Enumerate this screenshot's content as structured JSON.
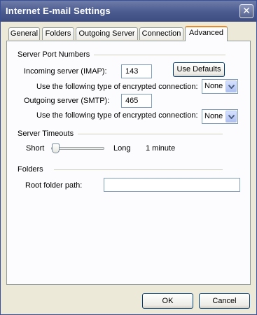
{
  "window": {
    "title": "Internet E-mail Settings",
    "close_glyph": "✕"
  },
  "tabs": [
    {
      "label": "General"
    },
    {
      "label": "Folders"
    },
    {
      "label": "Outgoing Server"
    },
    {
      "label": "Connection"
    },
    {
      "label": "Advanced",
      "active": true
    }
  ],
  "server_ports": {
    "section_title": "Server Port Numbers",
    "incoming_label": "Incoming server (IMAP):",
    "incoming_value": "143",
    "use_defaults_label": "Use Defaults",
    "incoming_encryption_label": "Use the following type of encrypted connection:",
    "incoming_encryption_value": "None",
    "outgoing_label": "Outgoing server (SMTP):",
    "outgoing_value": "465",
    "outgoing_encryption_label": "Use the following type of encrypted connection:",
    "outgoing_encryption_value": "None"
  },
  "timeouts": {
    "section_title": "Server Timeouts",
    "short_label": "Short",
    "long_label": "Long",
    "value_label": "1 minute",
    "slider_level": 0
  },
  "folders": {
    "section_title": "Folders",
    "root_label": "Root folder path:",
    "root_value": ""
  },
  "footer": {
    "ok_label": "OK",
    "cancel_label": "Cancel"
  },
  "colors": {
    "active_tab_accent": "#e68b2c",
    "title_bar": "#4a5a8f",
    "dialog_bg": "#ECE9D8"
  },
  "icons": {
    "close": "close-icon",
    "dropdown": "chevron-down-icon",
    "slider_thumb": "slider-thumb"
  }
}
